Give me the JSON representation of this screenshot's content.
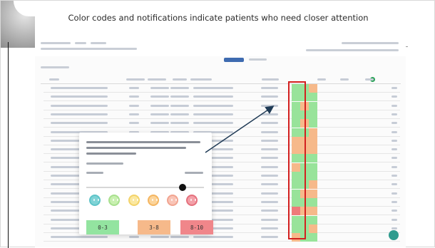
{
  "slide": {
    "heading": "Color codes and notifications indicate patients who need closer attention"
  },
  "legend": {
    "low_label": "0-3",
    "mid_label": "3-8",
    "high_label": "8-10"
  },
  "colors": {
    "green": "#98e39a",
    "orange": "#f6b98a",
    "red": "#ee7a7a",
    "highlight": "#d3201f",
    "primary": "#3e6bb0"
  },
  "popup": {
    "icons": [
      "face-very-happy-icon",
      "face-happy-icon",
      "face-neutral-icon",
      "face-unhappy-icon",
      "face-sad-icon",
      "face-very-sad-icon"
    ]
  }
}
